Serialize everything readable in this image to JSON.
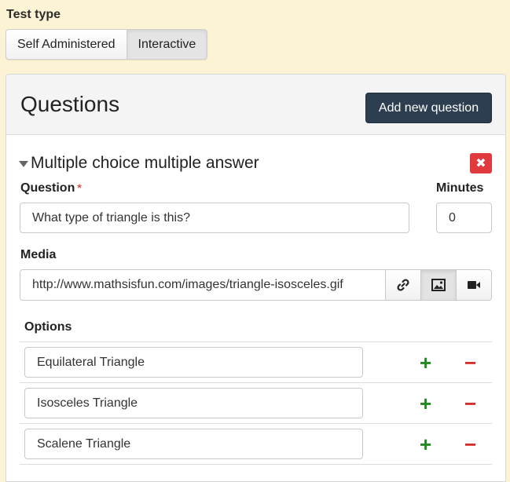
{
  "test_type": {
    "label": "Test type",
    "options": [
      "Self Administered",
      "Interactive"
    ],
    "selected": "Interactive"
  },
  "panel": {
    "title": "Questions",
    "add_button": "Add new question"
  },
  "question": {
    "type_title": "Multiple choice multiple answer",
    "question_label": "Question",
    "required_marker": "*",
    "question_value": "What type of triangle is this?",
    "minutes_label": "Minutes",
    "minutes_value": "0",
    "media_label": "Media",
    "media_value": "http://www.mathsisfun.com/images/triangle-isosceles.gif",
    "media_buttons": [
      "link-icon",
      "image-icon",
      "video-icon"
    ],
    "media_active": "image-icon",
    "options_label": "Options",
    "options": [
      "Equilateral Triangle",
      "Isosceles Triangle",
      "Scalene Triangle"
    ],
    "add_option_glyph": "+",
    "remove_option_glyph": "−",
    "delete_glyph": "✖"
  },
  "colors": {
    "background": "#fcf3d5",
    "primary_button": "#2c3e50",
    "delete": "#e0393e",
    "add": "#1f8b1f",
    "remove": "#d42c2c"
  }
}
